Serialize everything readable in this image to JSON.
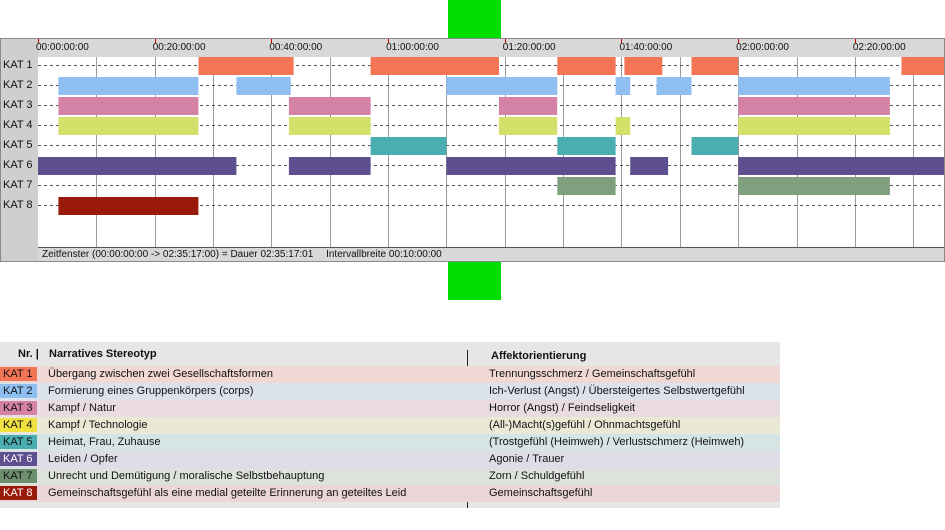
{
  "timeline": {
    "ticks": [
      "00:00:00:00",
      "00:20:00:00",
      "00:40:00:00",
      "01:00:00:00",
      "01:20:00:00",
      "01:40:00:00",
      "02:00:00:00",
      "02:20:00:00"
    ],
    "rows": [
      "KAT 1",
      "KAT 2",
      "KAT 3",
      "KAT 4",
      "KAT 5",
      "KAT 6",
      "KAT 7",
      "KAT 8"
    ],
    "status": {
      "window": "Zeitfenster (00:00:00:00 -> 02:35:17:00) = Dauer 02:35:17:01",
      "interval": "Intervallbreite 00:10:00:00"
    },
    "segments_minutes": [
      [
        [
          27.5,
          43.8
        ],
        [
          57,
          79
        ],
        [
          89,
          99
        ],
        [
          100.5,
          107
        ],
        [
          112,
          120
        ],
        [
          148,
          155.3
        ]
      ],
      [
        [
          3.5,
          27.5
        ],
        [
          34,
          43.3
        ],
        [
          70,
          89
        ],
        [
          99,
          101.5
        ],
        [
          106,
          112
        ],
        [
          120,
          146
        ]
      ],
      [
        [
          3.5,
          27.5
        ],
        [
          43,
          57
        ],
        [
          79,
          89
        ],
        [
          120,
          146
        ]
      ],
      [
        [
          3.5,
          27.5
        ],
        [
          43,
          57
        ],
        [
          79,
          89
        ],
        [
          99,
          101.5
        ],
        [
          120,
          146
        ]
      ],
      [
        [
          57,
          70
        ],
        [
          89,
          99
        ],
        [
          112,
          120
        ]
      ],
      [
        [
          0,
          34
        ],
        [
          43,
          57
        ],
        [
          70,
          99
        ],
        [
          101.5,
          108
        ],
        [
          120,
          155.3
        ]
      ],
      [
        [
          89,
          99
        ],
        [
          120,
          146
        ]
      ],
      [
        [
          3.5,
          27.5
        ]
      ]
    ],
    "colors": [
      "#f47555",
      "#8ebff0",
      "#d482a6",
      "#d3e06a",
      "#4aadaf",
      "#5e4f8f",
      "#7f9f7f",
      "#991a0a"
    ],
    "total_minutes": 155.28
  },
  "legend": {
    "headers": {
      "nr": "Nr. |",
      "stereotyp": "Narratives Stereotyp",
      "affekt": "Affektorientierung"
    },
    "rows": [
      {
        "kat": "KAT 1",
        "color": "#f47555",
        "bg": "#f0d8d4",
        "stereotyp": "Übergang zwischen zwei Gesellschaftsformen",
        "affekt": "Trennungsschmerz / Gemeinschaftsgefühl"
      },
      {
        "kat": "KAT 2",
        "color": "#8ebff0",
        "bg": "#dbe2ec",
        "stereotyp": "Formierung eines Gruppenkörpers (corps)",
        "affekt": "Ich-Verlust (Angst) / Übersteigertes Selbstwertgefühl"
      },
      {
        "kat": "KAT 3",
        "color": "#d482a6",
        "bg": "#e9dbe1",
        "stereotyp": "Kampf / Natur",
        "affekt": "Horror (Angst) / Feindseligkeit"
      },
      {
        "kat": "KAT 4",
        "color": "#f0e040",
        "bg": "#e9e9d6",
        "stereotyp": "Kampf / Technologie",
        "affekt": "(All-)Macht(s)gefühl / Ohnmachtsgefühl"
      },
      {
        "kat": "KAT 5",
        "color": "#4aadaf",
        "bg": "#d6e4e3",
        "stereotyp": "Heimat, Frau, Zuhause",
        "affekt": "(Trostgefühl (Heimweh) / Verlustschmerz (Heimweh)"
      },
      {
        "kat": "KAT 6",
        "color": "#5e4f8f",
        "bg": "#dedce6",
        "stereotyp": "Leiden / Opfer",
        "affekt": "Agonie / Trauer"
      },
      {
        "kat": "KAT 7",
        "color": "#6e8f6e",
        "bg": "#dde2dc",
        "stereotyp": "Unrecht und Demütigung / moralische Selbstbehauptung",
        "affekt": "Zorn / Schuldgefühl"
      },
      {
        "kat": "KAT 8",
        "color": "#991a0a",
        "bg": "#ead6d6",
        "stereotyp": "Gemeinschaftsgefühl als eine medial geteilte Erinnerung an geteiltes Leid",
        "affekt": "Gemeinschaftsgefühl"
      }
    ]
  }
}
